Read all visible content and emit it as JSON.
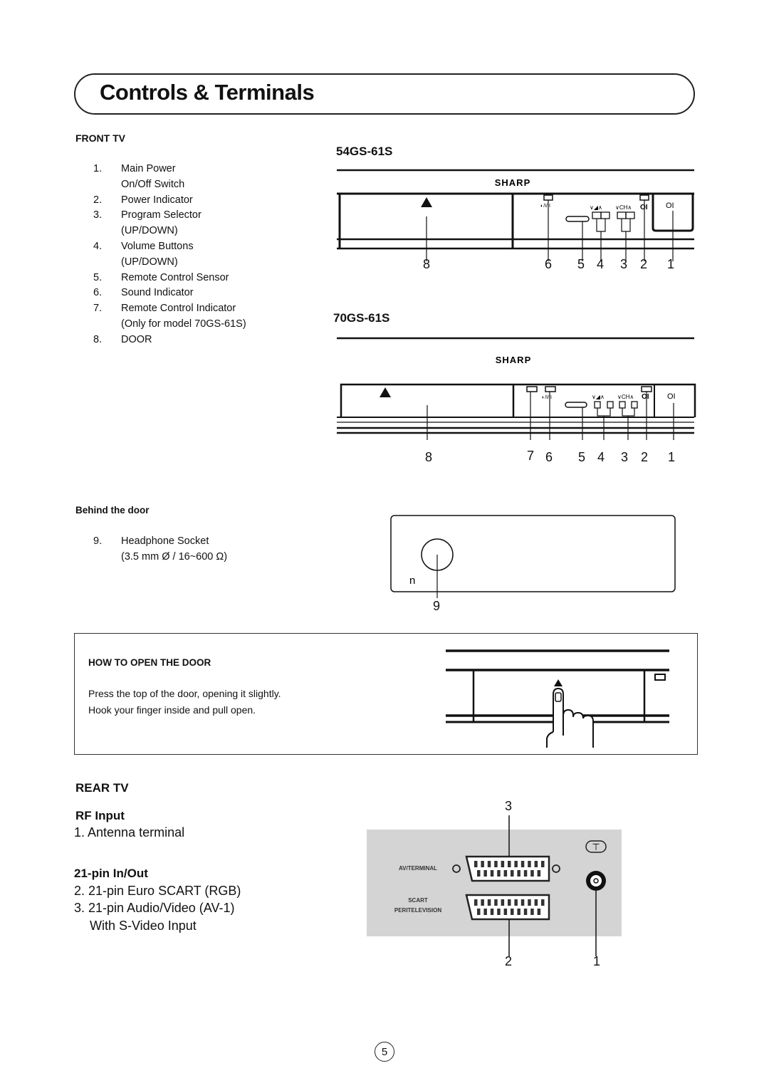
{
  "page": {
    "title": "Controls & Terminals",
    "page_number": "5"
  },
  "front_tv": {
    "heading": "FRONT TV",
    "items": [
      {
        "num": "1.",
        "lines": [
          "Main Power",
          "On/Off Switch"
        ]
      },
      {
        "num": "2.",
        "lines": [
          "Power Indicator"
        ]
      },
      {
        "num": "3.",
        "lines": [
          "Program Selector",
          "(UP/DOWN)"
        ]
      },
      {
        "num": "4.",
        "lines": [
          "Volume Buttons",
          "(UP/DOWN)"
        ]
      },
      {
        "num": "5.",
        "lines": [
          "Remote Control Sensor"
        ]
      },
      {
        "num": "6.",
        "lines": [
          "Sound Indicator"
        ]
      },
      {
        "num": "7.",
        "lines": [
          "Remote Control Indicator",
          "(Only for model 70GS-61S)"
        ]
      },
      {
        "num": "8.",
        "lines": [
          "DOOR"
        ]
      }
    ]
  },
  "diagrams": {
    "model_a": {
      "name": "54GS-61S",
      "brand": "SHARP",
      "callouts": [
        "8",
        "6",
        "5",
        "4",
        "3",
        "2",
        "1"
      ],
      "sound_label": "◐/I/II",
      "vol_label": "∨◢∧",
      "ch_label": "∨CH∧",
      "power_label": "OI"
    },
    "model_b": {
      "name": "70GS-61S",
      "brand": "SHARP",
      "callouts": [
        "8",
        "7",
        "6",
        "5",
        "4",
        "3",
        "2",
        "1"
      ],
      "sound_label": "◐/I/II",
      "vol_label": "∨◢∧",
      "ch_label": "∨CH∧",
      "power_label": "OI"
    }
  },
  "behind_door": {
    "heading": "Behind the door",
    "items": [
      {
        "num": "9.",
        "lines": [
          "Headphone Socket",
          "(3.5 mm Ø / 16~600 Ω)"
        ]
      }
    ],
    "panel_symbol": "n",
    "callout": "9"
  },
  "how_to_open": {
    "heading": "HOW TO OPEN THE DOOR",
    "lines": [
      "Press the top of the door, opening it slightly.",
      "Hook your finger inside and pull open."
    ]
  },
  "rear_tv": {
    "heading": "REAR TV",
    "rf_heading": "RF Input",
    "rf_items": [
      "1. Antenna terminal"
    ],
    "pin_heading": "21-pin In/Out",
    "pin_items": [
      "2. 21-pin Euro SCART (RGB)",
      "3. 21-pin Audio/Video (AV-1)",
      "With S-Video Input"
    ],
    "panel_labels": {
      "av": "AV/TERMINAL",
      "scart_1": "SCART",
      "scart_2": "PERITELEVISION",
      "antenna_symbol": "⊤"
    },
    "callouts": {
      "top": "3",
      "bottom_left": "2",
      "bottom_right": "1"
    },
    "panel_color": "#d4d4d4"
  }
}
